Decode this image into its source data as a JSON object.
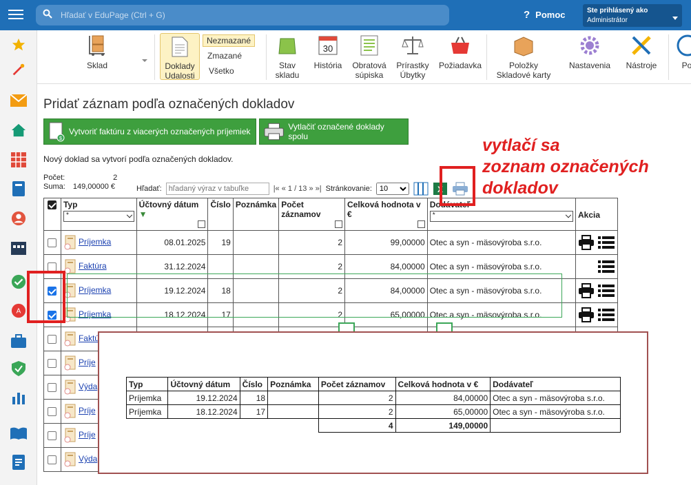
{
  "topbar": {
    "search_placeholder": "Hľadať v EduPage (Ctrl + G)",
    "help_label": "Pomoc",
    "user_line1": "Ste prihlásený ako",
    "user_line2": "Administrátor"
  },
  "ribbon": {
    "sklad": "Sklad",
    "doklady1": "Doklady",
    "doklady2": "Udalosti",
    "nezmazane": "Nezmazané",
    "zmazane": "Zmazané",
    "vsetko": "Všetko",
    "stav1": "Stav",
    "stav2": "skladu",
    "historia": "História",
    "calendar_day": "30",
    "obratova1": "Obratová",
    "obratova2": "súpiska",
    "prirastky1": "Prírastky",
    "prirastky2": "Úbytky",
    "poziadavka": "Požiadavka",
    "polozky1": "Položky",
    "polozky2": "Skladové karty",
    "nastavenia": "Nastavenia",
    "nastroje": "Nástroje",
    "po": "Po"
  },
  "page": {
    "title": "Pridať záznam podľa označených dokladov",
    "btn_invoice": "Vytvoriť faktúru z viacerých označených príjemiek",
    "btn_print": "Vytlačiť označené doklady spolu",
    "note": "Nový doklad sa vytvorí podľa označených dokladov.",
    "count_label": "Počet:",
    "count_value": "2",
    "sum_label": "Suma:",
    "sum_value": "149,00000 €",
    "search_label": "Hľadať:",
    "search_placeholder": "hľadaný výraz v tabuľke",
    "pager": "|« « 1 / 13 » »|",
    "paging_label": "Stránkovanie:",
    "paging_value": "10"
  },
  "annotation": {
    "line1": "vytlačí sa",
    "line2": "zoznam označených",
    "line3": "dokladov"
  },
  "table": {
    "headers": [
      "Typ",
      "Účtovný dátum",
      "Číslo",
      "Poznámka",
      "Počet záznamov",
      "Celková hodnota v €",
      "Dodávateľ",
      "Akcia"
    ],
    "filter_all": "*",
    "rows": [
      {
        "checked": false,
        "typ": "Príjemka",
        "datum": "08.01.2025",
        "cislo": "19",
        "pocet": "2",
        "hodnota": "99,00000",
        "dodavatel": "Otec a syn - mäsovýroba s.r.o.",
        "print": true
      },
      {
        "checked": false,
        "typ": "Faktúra",
        "datum": "31.12.2024",
        "cislo": "",
        "pocet": "2",
        "hodnota": "84,00000",
        "dodavatel": "Otec a syn - mäsovýroba s.r.o.",
        "print": false
      },
      {
        "checked": true,
        "typ": "Príjemka",
        "datum": "19.12.2024",
        "cislo": "18",
        "pocet": "2",
        "hodnota": "84,00000",
        "dodavatel": "Otec a syn - mäsovýroba s.r.o.",
        "print": true
      },
      {
        "checked": true,
        "typ": "Príjemka",
        "datum": "18.12.2024",
        "cislo": "17",
        "pocet": "2",
        "hodnota": "65,00000",
        "dodavatel": "Otec a syn - mäsovýroba s.r.o.",
        "print": true
      },
      {
        "checked": false,
        "typ": "Faktú",
        "datum": "",
        "cislo": "",
        "pocet": "",
        "hodnota": "",
        "dodavatel": "",
        "print": false
      },
      {
        "checked": false,
        "typ": "Príje",
        "datum": "",
        "cislo": "",
        "pocet": "",
        "hodnota": "",
        "dodavatel": "",
        "print": false
      },
      {
        "checked": false,
        "typ": "Výda",
        "datum": "",
        "cislo": "",
        "pocet": "",
        "hodnota": "",
        "dodavatel": "",
        "print": false
      },
      {
        "checked": false,
        "typ": "Príje",
        "datum": "",
        "cislo": "",
        "pocet": "",
        "hodnota": "",
        "dodavatel": "",
        "print": false
      },
      {
        "checked": false,
        "typ": "Príje",
        "datum": "",
        "cislo": "",
        "pocet": "",
        "hodnota": "",
        "dodavatel": "",
        "print": false
      },
      {
        "checked": false,
        "typ": "Výda",
        "datum": "",
        "cislo": "",
        "pocet": "",
        "hodnota": "",
        "dodavatel": "",
        "print": false
      }
    ]
  },
  "printout": {
    "headers": [
      "Typ",
      "Účtovný dátum",
      "Číslo",
      "Poznámka",
      "Počet záznamov",
      "Celková hodnota v €",
      "Dodávateľ"
    ],
    "rows": [
      [
        "Príjemka",
        "19.12.2024",
        "18",
        "",
        "2",
        "84,00000",
        "Otec a syn - mäsovýroba s.r.o."
      ],
      [
        "Príjemka",
        "18.12.2024",
        "17",
        "",
        "2",
        "65,00000",
        "Otec a syn - mäsovýroba s.r.o."
      ]
    ],
    "total_count": "4",
    "total_value": "149,00000"
  }
}
